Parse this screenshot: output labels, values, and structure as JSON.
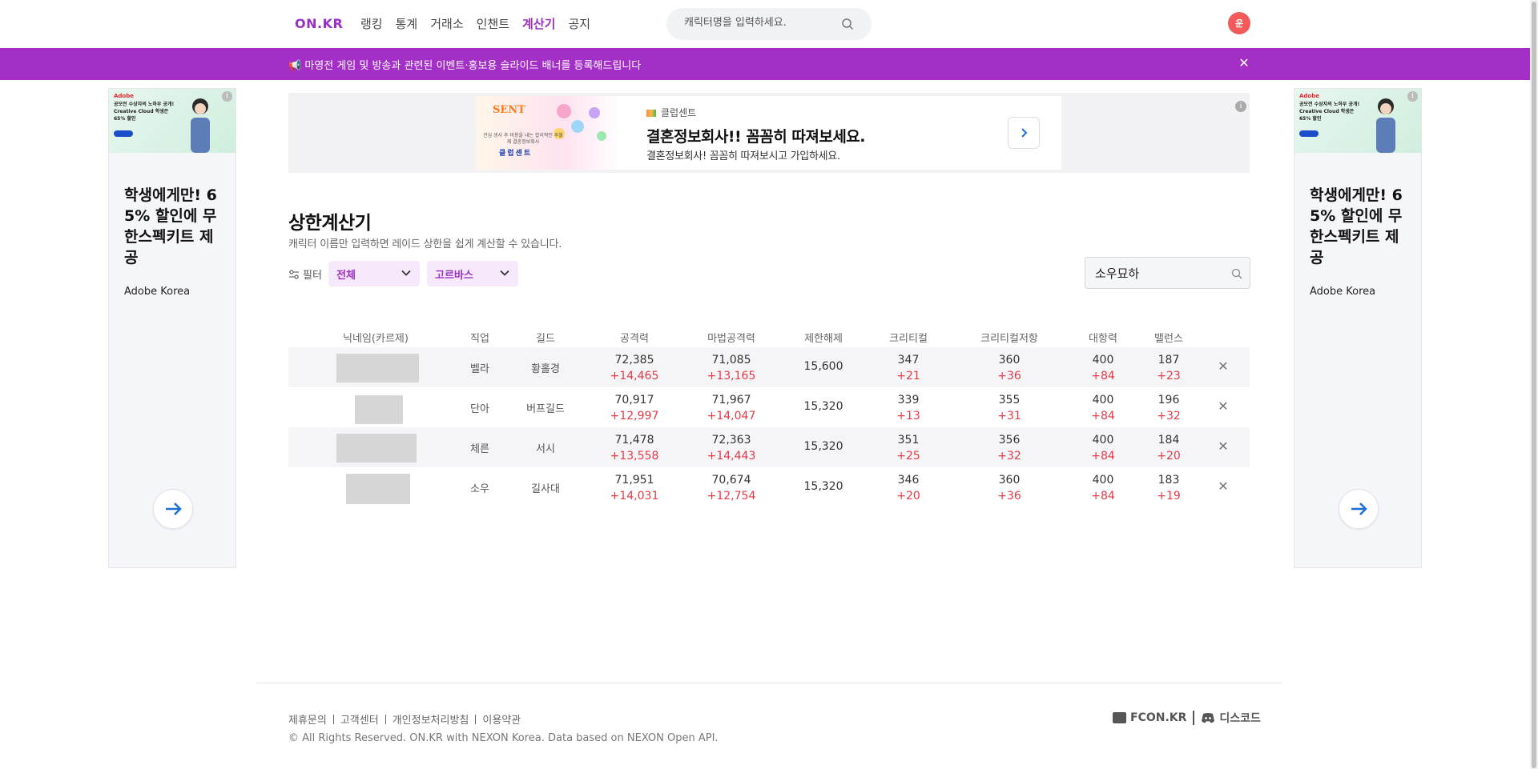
{
  "header": {
    "logo": "ON.KR",
    "nav": [
      "랭킹",
      "통계",
      "거래소",
      "인챈트",
      "계산기",
      "공지"
    ],
    "active_nav": "계산기",
    "search_placeholder": "캐릭터명을 입력하세요.",
    "avatar_text": "운"
  },
  "banner": {
    "text": "📢 마영전 게임 및 방송과 관련된 이벤트·홍보용 슬라이드 배너를 등록해드립니다",
    "color": "#a32fc6"
  },
  "side_ad": {
    "brand": "Adobe",
    "image_text": "공모전 수상자의 노하우 공개! Creative Cloud 학생은 65% 할인",
    "title": "학생에게만! 65% 할인에 무한스펙키트 제공",
    "company": "Adobe Korea"
  },
  "top_ad": {
    "brand": "클럽센트",
    "image_logo": "SENT",
    "image_text": "관심 생사 후 비용을 내는 합리적인 후불제 결혼정보회사",
    "image_club": "클럽센트",
    "title": "결혼정보회사!! 꼼꼼히 따져보세요.",
    "desc": "결혼정보회사! 꼼꼼히 따져보시고 가입하세요."
  },
  "calculator": {
    "title": "상한계산기",
    "subtitle": "캐릭터 이름만 입력하면 레이드 상한을 쉽게 계산할 수 있습니다.",
    "filter_label": "필터",
    "filter1": "전체",
    "filter2": "고르바스",
    "search_value": "소우묘하"
  },
  "table": {
    "headers": [
      "닉네임(카르제)",
      "직업",
      "길드",
      "공격력",
      "마법공격력",
      "제한해제",
      "크리티컬",
      "크리티컬저항",
      "대항력",
      "밸런스"
    ],
    "rows": [
      {
        "job": "벨라",
        "guild": "황홀경",
        "atk": "72,385",
        "atk_plus": "+14,465",
        "matk": "71,085",
        "matk_plus": "+13,165",
        "limit": "15,600",
        "crit": "347",
        "crit_plus": "+21",
        "critres": "360",
        "critres_plus": "+36",
        "res": "400",
        "res_plus": "+84",
        "bal": "187",
        "bal_plus": "+23"
      },
      {
        "job": "단아",
        "guild": "버프길드",
        "atk": "70,917",
        "atk_plus": "+12,997",
        "matk": "71,967",
        "matk_plus": "+14,047",
        "limit": "15,320",
        "crit": "339",
        "crit_plus": "+13",
        "critres": "355",
        "critres_plus": "+31",
        "res": "400",
        "res_plus": "+84",
        "bal": "196",
        "bal_plus": "+32"
      },
      {
        "job": "체른",
        "guild": "서시",
        "atk": "71,478",
        "atk_plus": "+13,558",
        "matk": "72,363",
        "matk_plus": "+14,443",
        "limit": "15,320",
        "crit": "351",
        "crit_plus": "+25",
        "critres": "356",
        "critres_plus": "+32",
        "res": "400",
        "res_plus": "+84",
        "bal": "184",
        "bal_plus": "+20"
      },
      {
        "job": "소우",
        "guild": "길사대",
        "atk": "71,951",
        "atk_plus": "+14,031",
        "matk": "70,674",
        "matk_plus": "+12,754",
        "limit": "15,320",
        "crit": "346",
        "crit_plus": "+20",
        "critres": "360",
        "critres_plus": "+36",
        "res": "400",
        "res_plus": "+84",
        "bal": "183",
        "bal_plus": "+19"
      }
    ]
  },
  "footer": {
    "links": [
      "제휴문의",
      "고객센터",
      "개인정보처리방침",
      "이용약관"
    ],
    "copyright": "© All Rights Reserved. ON.KR with NEXON Korea. Data based on NEXON Open API.",
    "fcon": "FCON.KR",
    "discord": "디스코드"
  },
  "colors": {
    "accent": "#9b2fc4",
    "plus_red": "#e53946",
    "avatar_red": "#f25a5a"
  }
}
